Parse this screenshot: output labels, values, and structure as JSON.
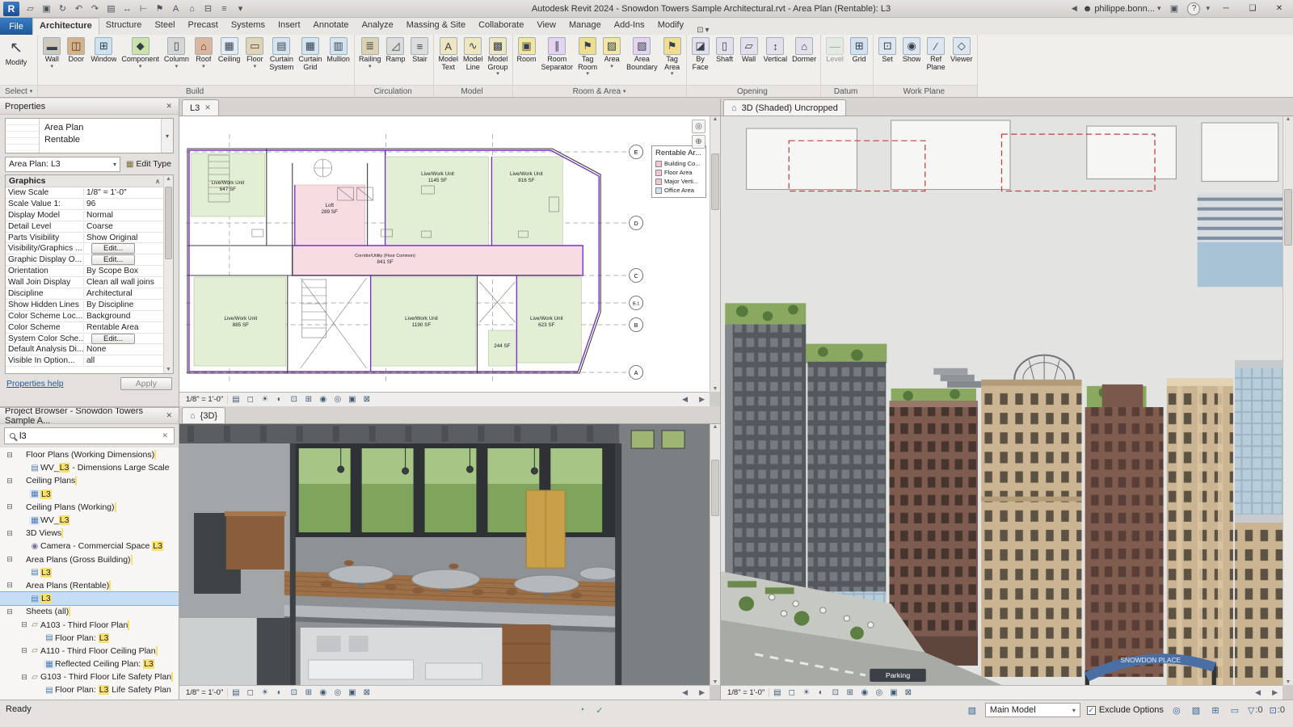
{
  "titlebar": {
    "title": "Autodesk Revit 2024 - Snowdon Towers Sample Architectural.rvt - Area Plan (Rentable): L3",
    "logo_glyph": "R",
    "qat": [
      {
        "name": "open",
        "glyph": "▱"
      },
      {
        "name": "save",
        "glyph": "▣"
      },
      {
        "name": "sync",
        "glyph": "↻"
      },
      {
        "name": "undo",
        "glyph": "↶"
      },
      {
        "name": "redo",
        "glyph": "↷"
      },
      {
        "name": "print",
        "glyph": "▤"
      },
      {
        "name": "measure",
        "glyph": "↔"
      },
      {
        "name": "aligned-dimension",
        "glyph": "⊢"
      },
      {
        "name": "tag-by-category",
        "glyph": "⚑"
      },
      {
        "name": "text",
        "glyph": "A"
      },
      {
        "name": "default-3d-view",
        "glyph": "⌂"
      },
      {
        "name": "section",
        "glyph": "⊟"
      },
      {
        "name": "thin-lines",
        "glyph": "≡"
      },
      {
        "name": "customize-qat",
        "glyph": "▾"
      }
    ],
    "collapse_glyph": "◀",
    "user": "philippe.bonn...",
    "help_glyph": "?",
    "window": {
      "minimize": "─",
      "maximize": "❑",
      "close": "✕"
    }
  },
  "ribbon": {
    "file_label": "File",
    "tabs": [
      {
        "label": "Architecture",
        "active": "true"
      },
      {
        "label": "Structure"
      },
      {
        "label": "Steel"
      },
      {
        "label": "Precast"
      },
      {
        "label": "Systems"
      },
      {
        "label": "Insert"
      },
      {
        "label": "Annotate"
      },
      {
        "label": "Analyze"
      },
      {
        "label": "Massing & Site"
      },
      {
        "label": "Collaborate"
      },
      {
        "label": "View"
      },
      {
        "label": "Manage"
      },
      {
        "label": "Add-Ins"
      },
      {
        "label": "Modify"
      }
    ],
    "panels": [
      {
        "label": "Select",
        "caret": "▾",
        "buttons": [
          {
            "label": "Modify",
            "glyph": "↖",
            "icon": "modify",
            "caret": ""
          }
        ]
      },
      {
        "label": "Build",
        "caret": "",
        "buttons": [
          {
            "label": "Wall",
            "glyph": "▬",
            "icon": "wall",
            "caret": "▾"
          },
          {
            "label": "Door",
            "glyph": "◫",
            "icon": "door",
            "caret": ""
          },
          {
            "label": "Window",
            "glyph": "⊞",
            "icon": "window",
            "caret": ""
          },
          {
            "label": "Component",
            "glyph": "◆",
            "icon": "component",
            "caret": "▾"
          },
          {
            "label": "Column",
            "glyph": "▯",
            "icon": "column",
            "caret": "▾"
          },
          {
            "label": "Roof",
            "glyph": "⌂",
            "icon": "roof",
            "caret": "▾"
          },
          {
            "label": "Ceiling",
            "glyph": "▦",
            "icon": "ceiling",
            "caret": ""
          },
          {
            "label": "Floor",
            "glyph": "▭",
            "icon": "floor",
            "caret": "▾"
          },
          {
            "label": "Curtain\nSystem",
            "glyph": "▤",
            "icon": "curtain-system",
            "caret": ""
          },
          {
            "label": "Curtain\nGrid",
            "glyph": "▦",
            "icon": "curtain-grid",
            "caret": ""
          },
          {
            "label": "Mullion",
            "glyph": "▥",
            "icon": "mullion",
            "caret": ""
          }
        ]
      },
      {
        "label": "Circulation",
        "caret": "",
        "buttons": [
          {
            "label": "Railing",
            "glyph": "≣",
            "icon": "railing",
            "caret": "▾"
          },
          {
            "label": "Ramp",
            "glyph": "◿",
            "icon": "ramp",
            "caret": ""
          },
          {
            "label": "Stair",
            "glyph": "≡",
            "icon": "stair",
            "caret": ""
          }
        ]
      },
      {
        "label": "Model",
        "caret": "",
        "buttons": [
          {
            "label": "Model\nText",
            "glyph": "A",
            "icon": "model-text",
            "caret": ""
          },
          {
            "label": "Model\nLine",
            "glyph": "∿",
            "icon": "model-line",
            "caret": ""
          },
          {
            "label": "Model\nGroup",
            "glyph": "▩",
            "icon": "model-group",
            "caret": "▾"
          }
        ]
      },
      {
        "label": "Room & Area",
        "caret": "▾",
        "buttons": [
          {
            "label": "Room",
            "glyph": "▣",
            "icon": "room",
            "caret": ""
          },
          {
            "label": "Room\nSeparator",
            "glyph": "∥",
            "icon": "room-separator",
            "caret": ""
          },
          {
            "label": "Tag\nRoom",
            "glyph": "⚑",
            "icon": "tag-room",
            "caret": "▾"
          },
          {
            "label": "Area",
            "glyph": "▨",
            "icon": "area",
            "caret": "▾"
          },
          {
            "label": "Area\nBoundary",
            "glyph": "▧",
            "icon": "area-boundary",
            "caret": ""
          },
          {
            "label": "Tag\nArea",
            "glyph": "⚑",
            "icon": "tag-area",
            "caret": "▾"
          }
        ]
      },
      {
        "label": "Opening",
        "caret": "",
        "buttons": [
          {
            "label": "By\nFace",
            "glyph": "◪",
            "icon": "by-face",
            "caret": ""
          },
          {
            "label": "Shaft",
            "glyph": "▯",
            "icon": "shaft",
            "caret": ""
          },
          {
            "label": "Wall",
            "glyph": "▱",
            "icon": "wall-opening",
            "caret": ""
          },
          {
            "label": "Vertical",
            "glyph": "↕",
            "icon": "vertical",
            "caret": ""
          },
          {
            "label": "Dormer",
            "glyph": "⌂",
            "icon": "dormer",
            "caret": ""
          }
        ]
      },
      {
        "label": "Datum",
        "caret": "",
        "buttons": [
          {
            "label": "Level",
            "glyph": "—",
            "icon": "level",
            "caret": "",
            "disabled": "true"
          },
          {
            "label": "Grid",
            "glyph": "⊞",
            "icon": "grid",
            "caret": ""
          }
        ]
      },
      {
        "label": "Work Plane",
        "caret": "",
        "buttons": [
          {
            "label": "Set",
            "glyph": "⊡",
            "icon": "set",
            "caret": ""
          },
          {
            "label": "Show",
            "glyph": "◉",
            "icon": "show",
            "caret": ""
          },
          {
            "label": "Ref\nPlane",
            "glyph": "∕",
            "icon": "ref-plane",
            "caret": ""
          },
          {
            "label": "Viewer",
            "glyph": "◇",
            "icon": "viewer",
            "caret": ""
          }
        ]
      }
    ]
  },
  "properties": {
    "title": "Properties",
    "close_glyph": "✕",
    "type_name": "Area Plan",
    "type_style": "Rentable",
    "instance_label": "Area Plan: L3",
    "edit_type_label": "Edit Type",
    "section": "Graphics",
    "rows": [
      {
        "label": "View Scale",
        "value": "1/8\" = 1'-0\"",
        "kind": "text"
      },
      {
        "label": "Scale Value    1:",
        "value": "96",
        "kind": "text"
      },
      {
        "label": "Display Model",
        "value": "Normal",
        "kind": "text"
      },
      {
        "label": "Detail Level",
        "value": "Coarse",
        "kind": "text"
      },
      {
        "label": "Parts Visibility",
        "value": "Show Original",
        "kind": "text"
      },
      {
        "label": "Visibility/Graphics ...",
        "value": "Edit...",
        "kind": "button"
      },
      {
        "label": "Graphic Display O...",
        "value": "Edit...",
        "kind": "button"
      },
      {
        "label": "Orientation",
        "value": "By Scope Box",
        "kind": "text"
      },
      {
        "label": "Wall Join Display",
        "value": "Clean all wall joins",
        "kind": "text"
      },
      {
        "label": "Discipline",
        "value": "Architectural",
        "kind": "text"
      },
      {
        "label": "Show Hidden Lines",
        "value": "By Discipline",
        "kind": "text"
      },
      {
        "label": "Color Scheme Loc...",
        "value": "Background",
        "kind": "text"
      },
      {
        "label": "Color Scheme",
        "value": "Rentable Area",
        "kind": "text"
      },
      {
        "label": "System Color Sche...",
        "value": "Edit...",
        "kind": "button"
      },
      {
        "label": "Default Analysis Di...",
        "value": "None",
        "kind": "text"
      },
      {
        "label": "Visible In Option...",
        "value": "all",
        "kind": "text"
      }
    ],
    "help_link": "Properties help",
    "apply_label": "Apply"
  },
  "browser": {
    "title": "Project Browser - Snowdon Towers Sample A...",
    "close_glyph": "✕",
    "search_value": "l3",
    "items": [
      {
        "level": "0",
        "expander": "⊟",
        "icon": "folder",
        "pre": "Floor Plans (Working Dimensions)",
        "match": "",
        "post": ""
      },
      {
        "level": "1",
        "expander": "",
        "icon": "plan",
        "pre": "WV_",
        "match": "L3",
        "post": " - Dimensions Large Scale"
      },
      {
        "level": "0",
        "expander": "⊟",
        "icon": "folder",
        "pre": "Ceiling Plans",
        "match": "",
        "post": ""
      },
      {
        "level": "1",
        "expander": "",
        "icon": "ceiling",
        "pre": "",
        "match": "L3",
        "post": ""
      },
      {
        "level": "0",
        "expander": "⊟",
        "icon": "folder",
        "pre": "Ceiling Plans (Working)",
        "match": "",
        "post": ""
      },
      {
        "level": "1",
        "expander": "",
        "icon": "ceiling",
        "pre": "WV_",
        "match": "L3",
        "post": ""
      },
      {
        "level": "0",
        "expander": "⊟",
        "icon": "folder",
        "pre": "3D Views",
        "match": "",
        "post": ""
      },
      {
        "level": "1",
        "expander": "",
        "icon": "camera",
        "pre": "Camera - Commercial Space ",
        "match": "L3",
        "post": ""
      },
      {
        "level": "0",
        "expander": "⊟",
        "icon": "folder",
        "pre": "Area Plans (Gross Building)",
        "match": "",
        "post": ""
      },
      {
        "level": "1",
        "expander": "",
        "icon": "plan",
        "pre": "",
        "match": "L3",
        "post": ""
      },
      {
        "level": "0",
        "expander": "⊟",
        "icon": "folder",
        "pre": "Area Plans (Rentable)",
        "match": "",
        "post": ""
      },
      {
        "level": "1",
        "expander": "",
        "icon": "plan",
        "pre": "",
        "match": "L3",
        "post": "",
        "selected": "true"
      },
      {
        "level": "0",
        "expander": "⊟",
        "icon": "folder",
        "pre": "Sheets (all)",
        "match": "",
        "post": ""
      },
      {
        "level": "1",
        "expander": "⊟",
        "icon": "sheet",
        "pre": "A103 - Third Floor Plan",
        "match": "",
        "post": ""
      },
      {
        "level": "2",
        "expander": "",
        "icon": "plan",
        "pre": "Floor Plan: ",
        "match": "L3",
        "post": ""
      },
      {
        "level": "1",
        "expander": "⊟",
        "icon": "sheet",
        "pre": "A110 - Third Floor Ceiling Plan",
        "match": "",
        "post": ""
      },
      {
        "level": "2",
        "expander": "",
        "icon": "ceiling",
        "pre": "Reflected Ceiling Plan: ",
        "match": "L3",
        "post": ""
      },
      {
        "level": "1",
        "expander": "⊟",
        "icon": "sheet",
        "pre": "G103 - Third Floor Life Safety Plan",
        "match": "",
        "post": ""
      },
      {
        "level": "2",
        "expander": "",
        "icon": "plan",
        "pre": "Floor Plan: ",
        "match": "L3",
        "post": " Life Safety Plan"
      }
    ]
  },
  "vcb": {
    "icons": [
      {
        "name": "detail-level",
        "glyph": "▤"
      },
      {
        "name": "visual-style",
        "glyph": "◻"
      },
      {
        "name": "sun-path",
        "glyph": "☀"
      },
      {
        "name": "shadows",
        "glyph": "◐"
      },
      {
        "name": "crop-view",
        "glyph": "⊡"
      },
      {
        "name": "show-crop-region",
        "glyph": "⊞"
      },
      {
        "name": "temporary-hide-isolate",
        "glyph": "◉"
      },
      {
        "name": "reveal-hidden-elements",
        "glyph": "◎"
      },
      {
        "name": "temporary-view-properties",
        "glyph": "▣"
      },
      {
        "name": "reveal-constraints",
        "glyph": "⊠"
      }
    ]
  },
  "views": {
    "floorplan": {
      "tab": "L3",
      "scale": "1/8\" = 1'-0\"",
      "grids": [
        "E",
        "D",
        "C",
        "B.1",
        "B",
        "A"
      ],
      "rooms": [
        {
          "name": "Live/Work Unit",
          "area": "647 SF"
        },
        {
          "name": "Loft",
          "area": "289 SF"
        },
        {
          "name": "Live/Work Unit",
          "area": "1145 SF"
        },
        {
          "name": "Live/Work Unit",
          "area": "816 SF"
        },
        {
          "name": "Corridor/Utility (Floor Common)",
          "area": "841 SF"
        },
        {
          "name": "Live/Work Unit",
          "area": "885 SF"
        },
        {
          "name": "Live/Work Unit",
          "area": "1190 SF"
        },
        {
          "name": "",
          "area": "244 SF"
        },
        {
          "name": "Live/Work Unit",
          "area": "623 SF"
        }
      ],
      "legend": {
        "title": "Rentable Ar...",
        "items": [
          {
            "color": "#f3c6d0",
            "label": "Building Co..."
          },
          {
            "color": "#f3c6d0",
            "label": "Floor Area"
          },
          {
            "color": "#f3c6d0",
            "label": "Major Verti..."
          },
          {
            "color": "#cfe2f3",
            "label": "Office Area"
          }
        ]
      }
    },
    "interior": {
      "tab": "{3D}",
      "scale": "1/8\" = 1'-0\""
    },
    "exterior": {
      "tab": "3D (Shaded) Uncropped",
      "scale": "1/8\" = 1'-0\"",
      "arch_text": "SNOWDON  PLACE",
      "parking_text": "Parking"
    }
  },
  "status": {
    "ready": "Ready",
    "center_icons": [
      {
        "name": "performance-indicator",
        "glyph": "◔"
      },
      {
        "name": "sync-indicator",
        "glyph": "✓"
      }
    ],
    "design_options_glyph": "▧",
    "main_model": "Main Model",
    "exclude_options": "Exclude Options",
    "check_glyph": "✓",
    "right_icons": [
      {
        "name": "editable-only",
        "glyph": "◎"
      },
      {
        "name": "worksharing-display",
        "glyph": "▧"
      },
      {
        "name": "links",
        "glyph": "⊞"
      },
      {
        "name": "press-drag",
        "glyph": "▭"
      }
    ],
    "filter_glyph": "▽",
    "filter_count": ":0",
    "select_glyph": "⊡",
    "select_count": ":0"
  }
}
